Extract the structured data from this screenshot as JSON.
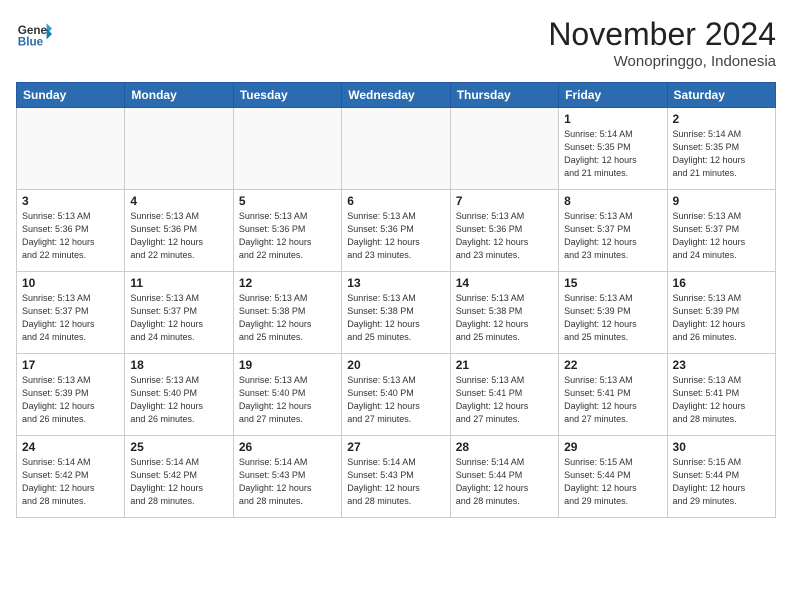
{
  "header": {
    "logo_line1": "General",
    "logo_line2": "Blue",
    "month": "November 2024",
    "location": "Wonopringgo, Indonesia"
  },
  "days_of_week": [
    "Sunday",
    "Monday",
    "Tuesday",
    "Wednesday",
    "Thursday",
    "Friday",
    "Saturday"
  ],
  "weeks": [
    [
      {
        "day": "",
        "info": ""
      },
      {
        "day": "",
        "info": ""
      },
      {
        "day": "",
        "info": ""
      },
      {
        "day": "",
        "info": ""
      },
      {
        "day": "",
        "info": ""
      },
      {
        "day": "1",
        "info": "Sunrise: 5:14 AM\nSunset: 5:35 PM\nDaylight: 12 hours\nand 21 minutes."
      },
      {
        "day": "2",
        "info": "Sunrise: 5:14 AM\nSunset: 5:35 PM\nDaylight: 12 hours\nand 21 minutes."
      }
    ],
    [
      {
        "day": "3",
        "info": "Sunrise: 5:13 AM\nSunset: 5:36 PM\nDaylight: 12 hours\nand 22 minutes."
      },
      {
        "day": "4",
        "info": "Sunrise: 5:13 AM\nSunset: 5:36 PM\nDaylight: 12 hours\nand 22 minutes."
      },
      {
        "day": "5",
        "info": "Sunrise: 5:13 AM\nSunset: 5:36 PM\nDaylight: 12 hours\nand 22 minutes."
      },
      {
        "day": "6",
        "info": "Sunrise: 5:13 AM\nSunset: 5:36 PM\nDaylight: 12 hours\nand 23 minutes."
      },
      {
        "day": "7",
        "info": "Sunrise: 5:13 AM\nSunset: 5:36 PM\nDaylight: 12 hours\nand 23 minutes."
      },
      {
        "day": "8",
        "info": "Sunrise: 5:13 AM\nSunset: 5:37 PM\nDaylight: 12 hours\nand 23 minutes."
      },
      {
        "day": "9",
        "info": "Sunrise: 5:13 AM\nSunset: 5:37 PM\nDaylight: 12 hours\nand 24 minutes."
      }
    ],
    [
      {
        "day": "10",
        "info": "Sunrise: 5:13 AM\nSunset: 5:37 PM\nDaylight: 12 hours\nand 24 minutes."
      },
      {
        "day": "11",
        "info": "Sunrise: 5:13 AM\nSunset: 5:37 PM\nDaylight: 12 hours\nand 24 minutes."
      },
      {
        "day": "12",
        "info": "Sunrise: 5:13 AM\nSunset: 5:38 PM\nDaylight: 12 hours\nand 25 minutes."
      },
      {
        "day": "13",
        "info": "Sunrise: 5:13 AM\nSunset: 5:38 PM\nDaylight: 12 hours\nand 25 minutes."
      },
      {
        "day": "14",
        "info": "Sunrise: 5:13 AM\nSunset: 5:38 PM\nDaylight: 12 hours\nand 25 minutes."
      },
      {
        "day": "15",
        "info": "Sunrise: 5:13 AM\nSunset: 5:39 PM\nDaylight: 12 hours\nand 25 minutes."
      },
      {
        "day": "16",
        "info": "Sunrise: 5:13 AM\nSunset: 5:39 PM\nDaylight: 12 hours\nand 26 minutes."
      }
    ],
    [
      {
        "day": "17",
        "info": "Sunrise: 5:13 AM\nSunset: 5:39 PM\nDaylight: 12 hours\nand 26 minutes."
      },
      {
        "day": "18",
        "info": "Sunrise: 5:13 AM\nSunset: 5:40 PM\nDaylight: 12 hours\nand 26 minutes."
      },
      {
        "day": "19",
        "info": "Sunrise: 5:13 AM\nSunset: 5:40 PM\nDaylight: 12 hours\nand 27 minutes."
      },
      {
        "day": "20",
        "info": "Sunrise: 5:13 AM\nSunset: 5:40 PM\nDaylight: 12 hours\nand 27 minutes."
      },
      {
        "day": "21",
        "info": "Sunrise: 5:13 AM\nSunset: 5:41 PM\nDaylight: 12 hours\nand 27 minutes."
      },
      {
        "day": "22",
        "info": "Sunrise: 5:13 AM\nSunset: 5:41 PM\nDaylight: 12 hours\nand 27 minutes."
      },
      {
        "day": "23",
        "info": "Sunrise: 5:13 AM\nSunset: 5:41 PM\nDaylight: 12 hours\nand 28 minutes."
      }
    ],
    [
      {
        "day": "24",
        "info": "Sunrise: 5:14 AM\nSunset: 5:42 PM\nDaylight: 12 hours\nand 28 minutes."
      },
      {
        "day": "25",
        "info": "Sunrise: 5:14 AM\nSunset: 5:42 PM\nDaylight: 12 hours\nand 28 minutes."
      },
      {
        "day": "26",
        "info": "Sunrise: 5:14 AM\nSunset: 5:43 PM\nDaylight: 12 hours\nand 28 minutes."
      },
      {
        "day": "27",
        "info": "Sunrise: 5:14 AM\nSunset: 5:43 PM\nDaylight: 12 hours\nand 28 minutes."
      },
      {
        "day": "28",
        "info": "Sunrise: 5:14 AM\nSunset: 5:44 PM\nDaylight: 12 hours\nand 28 minutes."
      },
      {
        "day": "29",
        "info": "Sunrise: 5:15 AM\nSunset: 5:44 PM\nDaylight: 12 hours\nand 29 minutes."
      },
      {
        "day": "30",
        "info": "Sunrise: 5:15 AM\nSunset: 5:44 PM\nDaylight: 12 hours\nand 29 minutes."
      }
    ]
  ]
}
